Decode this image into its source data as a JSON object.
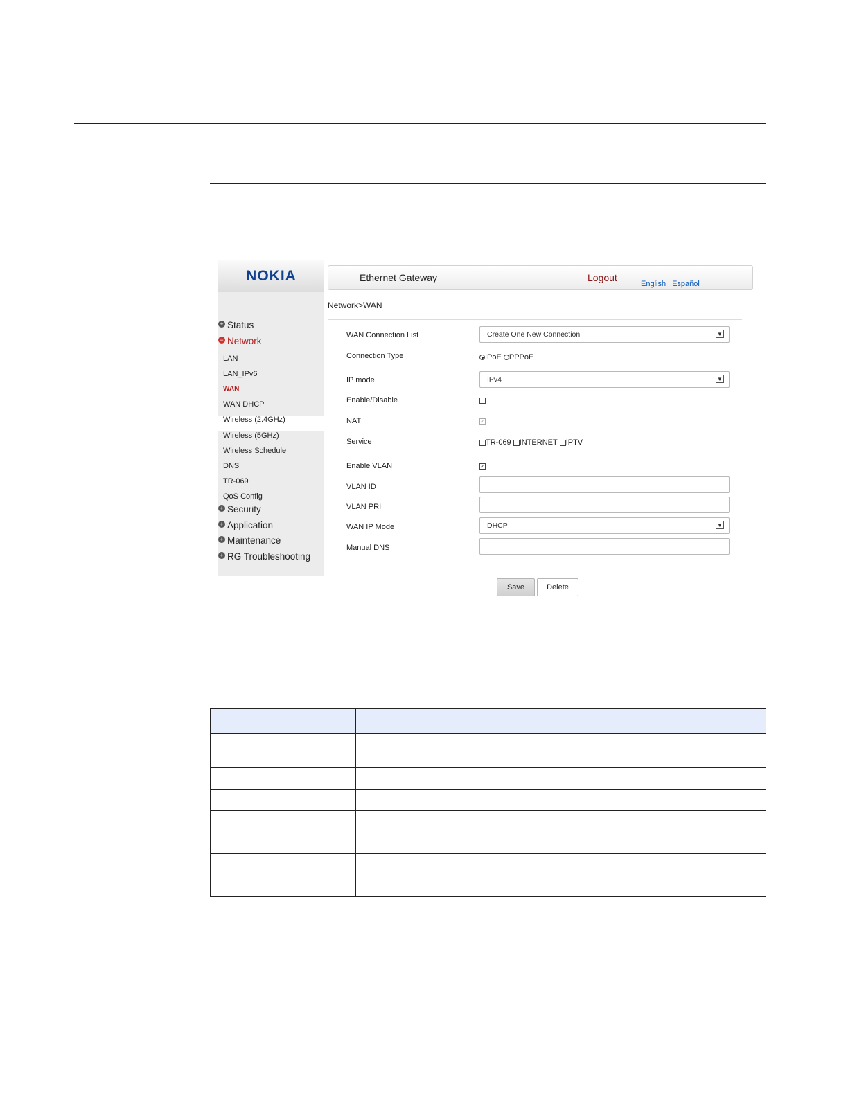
{
  "app": {
    "logo": "NOKIA",
    "title": "Ethernet Gateway",
    "logout": "Logout",
    "lang_english": "English",
    "lang_separator": "|",
    "lang_espanol": "Español",
    "brand_color": "#124191",
    "accent_color": "#b31b1b"
  },
  "sidebar": {
    "status": "Status",
    "network": "Network",
    "network_items": [
      "LAN",
      "LAN_IPv6",
      "WAN",
      "WAN DHCP",
      "Wireless (2.4GHz)",
      "Wireless (5GHz)",
      "Wireless Schedule",
      "DNS",
      "TR-069",
      "QoS Config"
    ],
    "active_item": "WAN",
    "security": "Security",
    "application": "Application",
    "maintenance": "Maintenance",
    "rg_troubleshooting": "RG Troubleshooting",
    "expand_icon": "plus-circle-icon",
    "collapse_icon": "minus-circle-icon"
  },
  "breadcrumb": "Network>WAN",
  "form": {
    "wan_connection_list": {
      "label": "WAN Connection List",
      "value": "Create One New Connection"
    },
    "connection_type": {
      "label": "Connection Type",
      "options": [
        "IPoE",
        "PPPoE"
      ],
      "selected": "IPoE"
    },
    "ip_mode": {
      "label": "IP mode",
      "value": "IPv4"
    },
    "enable_disable": {
      "label": "Enable/Disable",
      "checked": false
    },
    "nat": {
      "label": "NAT",
      "checked": true,
      "disabled": true
    },
    "service": {
      "label": "Service",
      "options": [
        "TR-069",
        "INTERNET",
        "IPTV"
      ]
    },
    "enable_vlan": {
      "label": "Enable VLAN",
      "checked": true
    },
    "vlan_id": {
      "label": "VLAN ID",
      "value": ""
    },
    "vlan_pri": {
      "label": "VLAN PRI",
      "value": ""
    },
    "wan_ip_mode": {
      "label": "WAN IP Mode",
      "value": "DHCP"
    },
    "manual_dns": {
      "label": "Manual DNS",
      "value": ""
    }
  },
  "buttons": {
    "save": "Save",
    "delete": "Delete"
  },
  "table": {
    "header_color": "#e5ecfb",
    "body_rows": 7
  }
}
